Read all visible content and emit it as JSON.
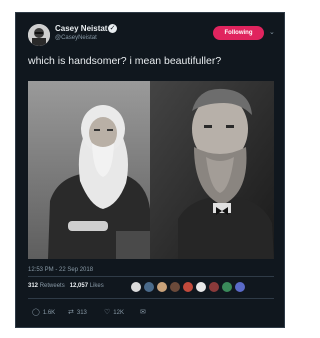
{
  "tweet": {
    "author_name": "Casey Neistat",
    "handle": "@CaseyNeistat",
    "follow_label": "Following",
    "text": "which is handsomer?  i mean beautifuller?",
    "timestamp": "12:53 PM - 22 Sep 2018",
    "retweets_count": "312",
    "retweets_label": "Retweets",
    "likes_count": "12,057",
    "likes_label": "Likes",
    "likers_avatars": 9
  },
  "actions": {
    "reply_count": "1.6K",
    "retweet_count": "313",
    "like_count": "12K"
  },
  "icons": {
    "reply": "reply-icon",
    "retweet": "retweet-icon",
    "like": "heart-icon",
    "message": "message-icon",
    "verified": "verified-badge-icon",
    "menu": "chevron-down-icon"
  },
  "colors": {
    "background": "#10171e",
    "accent": "#e0245e",
    "text_primary": "#e9edf0",
    "text_secondary": "#8899a6"
  }
}
